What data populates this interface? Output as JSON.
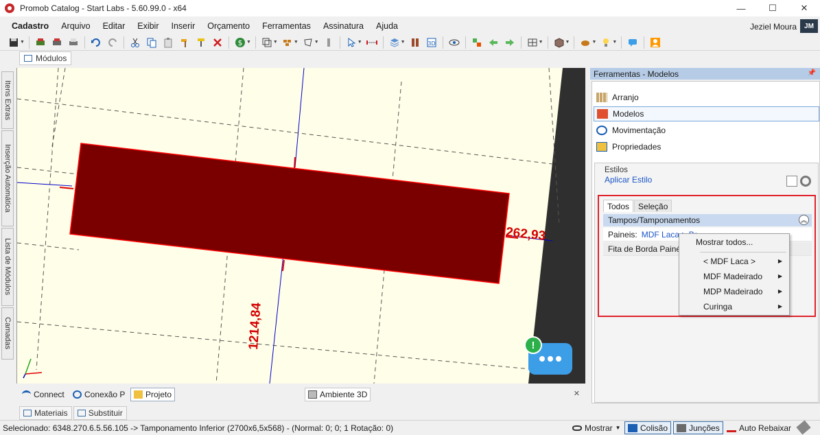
{
  "window": {
    "title": "Promob Catalog - Start Labs - 5.60.99.0 - x64",
    "minimize": "—",
    "maximize": "☐",
    "close": "✕"
  },
  "menu": {
    "items": [
      "Cadastro",
      "Arquivo",
      "Editar",
      "Exibir",
      "Inserir",
      "Orçamento",
      "Ferramentas",
      "Assinatura",
      "Ajuda"
    ],
    "user_name": "Jeziel Moura",
    "user_initials": "JM"
  },
  "doc_tab": {
    "label": "Módulos"
  },
  "side_tabs": [
    "Itens Extras",
    "Inserção Automática",
    "Lista de Módulos",
    "Camadas"
  ],
  "viewport": {
    "dim_right": "262,93",
    "dim_bottom": "1214,84",
    "alert": "!",
    "colors": {
      "background": "#fffee8",
      "panel": "#7a0000",
      "outline": "#ff0000",
      "dimension": "#d40000",
      "guide": "#0000cc"
    }
  },
  "viewport_tabs": {
    "connect": "Connect",
    "conexao": "Conexão P",
    "projeto": "Projeto",
    "ambiente": "Ambiente 3D",
    "close": "✕"
  },
  "bottom_tabs": {
    "materiais": "Materiais",
    "substituir": "Substituir"
  },
  "status": {
    "selected": "Selecionado: 6348.270.6.5.56.105 -> Tamponamento Inferior (2700x6,5x568) - (Normal: 0; 0; 1 Rotação: 0)",
    "mostrar": "Mostrar",
    "colisao": "Colisão",
    "juncoes": "Junções",
    "auto_rebaixar": "Auto Rebaixar"
  },
  "right_panel": {
    "header": "Ferramentas - Modelos",
    "tools": [
      "Arranjo",
      "Modelos",
      "Movimentação",
      "Propriedades"
    ],
    "estilos": {
      "title": "Estilos",
      "apply": "Aplicar Estilo",
      "tabs": {
        "todos": "Todos",
        "selecao": "Seleção"
      },
      "group": "Tampos/Tamponamentos",
      "rows": {
        "paineis_label": "Paineis:",
        "paineis_value": "MDF Laca > Br...",
        "fita": "Fita de Borda Painéis"
      }
    }
  },
  "context_menu": {
    "show_all": "Mostrar todos...",
    "items": [
      "< MDF Laca >",
      "MDF Madeirado",
      "MDP Madeirado",
      "Curinga"
    ]
  }
}
